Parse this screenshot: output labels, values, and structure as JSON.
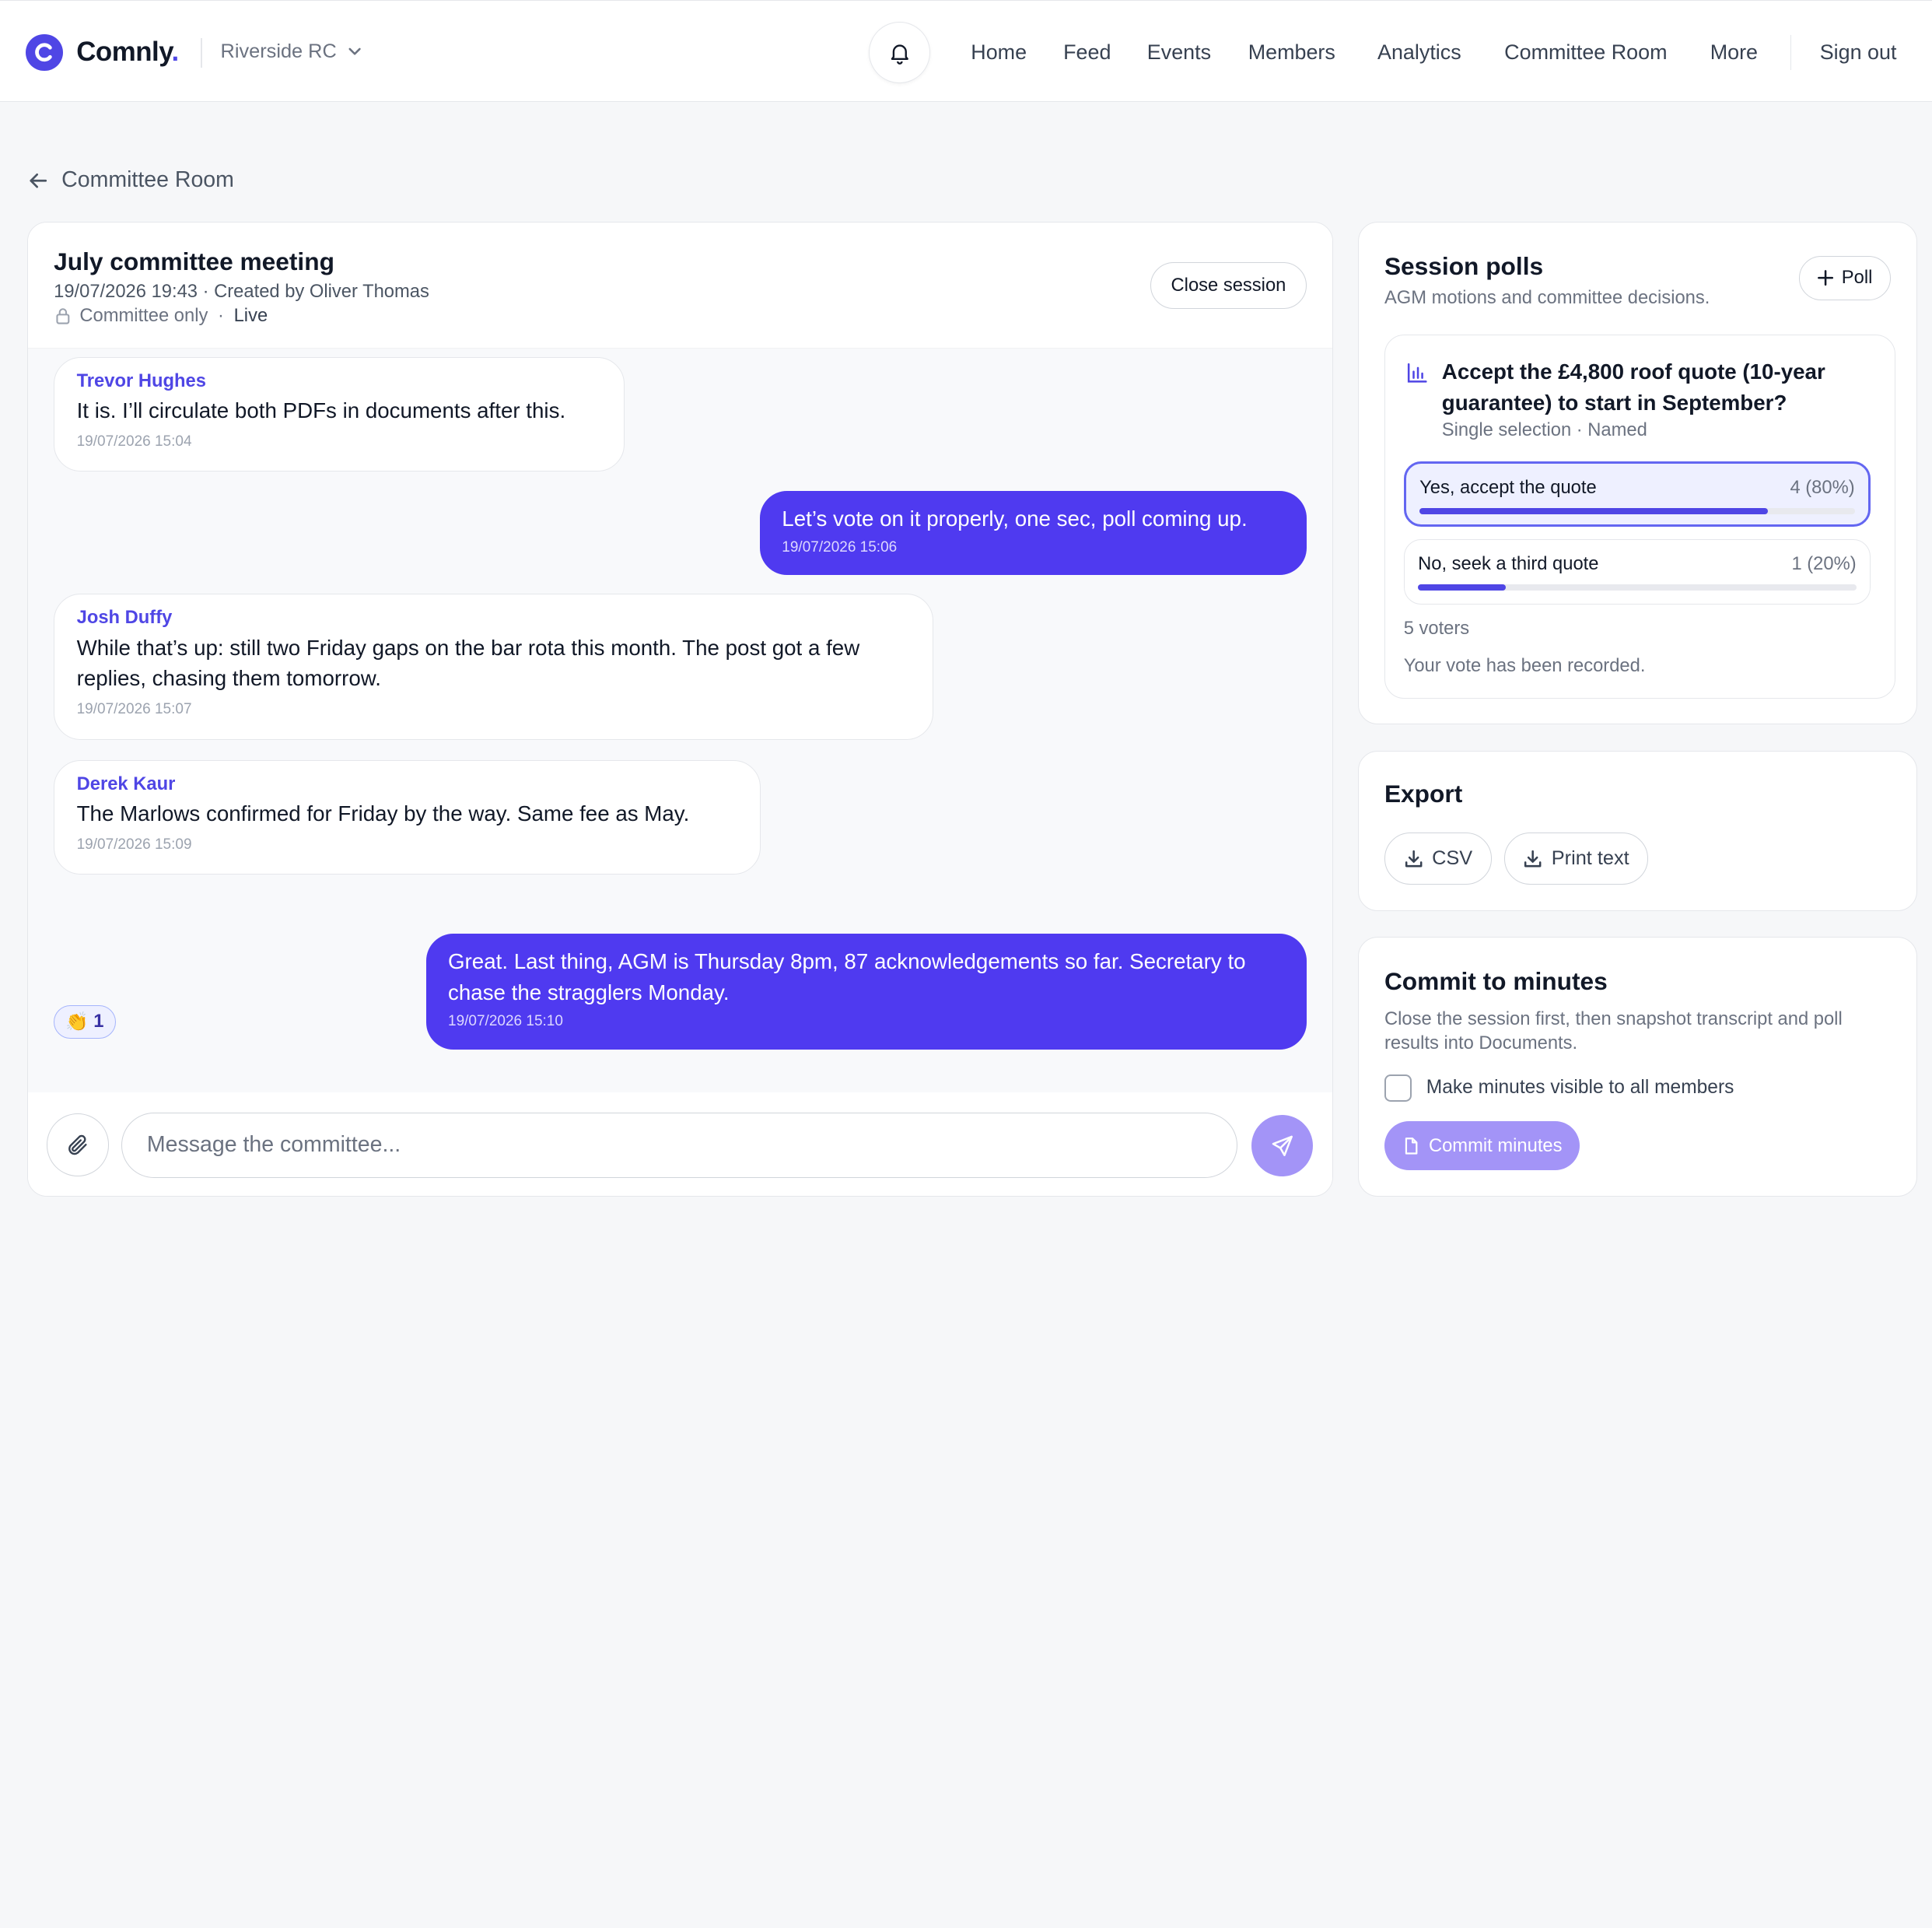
{
  "brand": {
    "name": "Comnly",
    "dot": ".",
    "accent": "#4f46e5"
  },
  "club": {
    "name": "Riverside RC"
  },
  "nav": {
    "items": [
      "Home",
      "Feed",
      "Events",
      "Members",
      "Analytics",
      "Committee Room",
      "More"
    ],
    "sign_out": "Sign out"
  },
  "breadcrumb": {
    "label": "Committee Room"
  },
  "meeting": {
    "title": "July committee meeting",
    "meta": "19/07/2026 19:43 · Created by Oliver Thomas",
    "access": "Committee only",
    "separator": "·",
    "status": "Live",
    "close_label": "Close session"
  },
  "messages": [
    {
      "author": "Trevor Hughes",
      "text": "It is. I’ll circulate both PDFs in documents after this.",
      "time": "19/07/2026 15:04",
      "own": false
    },
    {
      "author": "",
      "text": "Let’s vote on it properly, one sec, poll coming up.",
      "time": "19/07/2026 15:06",
      "own": true
    },
    {
      "author": "Josh Duffy",
      "text": "While that’s up: still two Friday gaps on the bar rota this month. The post got a few replies, chasing them tomorrow.",
      "time": "19/07/2026 15:07",
      "own": false
    },
    {
      "author": "Derek Kaur",
      "text": "The Marlows confirmed for Friday by the way. Same fee as May.",
      "time": "19/07/2026 15:09",
      "own": false
    },
    {
      "author": "",
      "text": "Great. Last thing, AGM is Thursday 8pm, 87 acknowledgements so far. Secretary to chase the stragglers Monday.",
      "time": "19/07/2026 15:10",
      "own": true
    }
  ],
  "reaction": {
    "emoji": "👏",
    "count": "1"
  },
  "composer": {
    "placeholder": "Message the committee..."
  },
  "polls": {
    "title": "Session polls",
    "subtitle": "AGM motions and committee decisions.",
    "add_label": "Poll",
    "question": "Accept the £4,800 roof quote (10-year guarantee) to start in September?",
    "meta": "Single selection · Named",
    "options": [
      {
        "label": "Yes, accept the quote",
        "count": "4 (80%)",
        "fraction": 0.8,
        "selected": true
      },
      {
        "label": "No, seek a third quote",
        "count": "1 (20%)",
        "fraction": 0.2,
        "selected": false
      }
    ],
    "voters": "5 voters",
    "status": "Your vote has been recorded."
  },
  "export": {
    "title": "Export",
    "csv_label": "CSV",
    "print_label": "Print text"
  },
  "minutes": {
    "title": "Commit to minutes",
    "description": "Close the session first, then snapshot transcript and poll results into Documents.",
    "checkbox_label": "Make minutes visible to all members",
    "button_label": "Commit minutes"
  }
}
